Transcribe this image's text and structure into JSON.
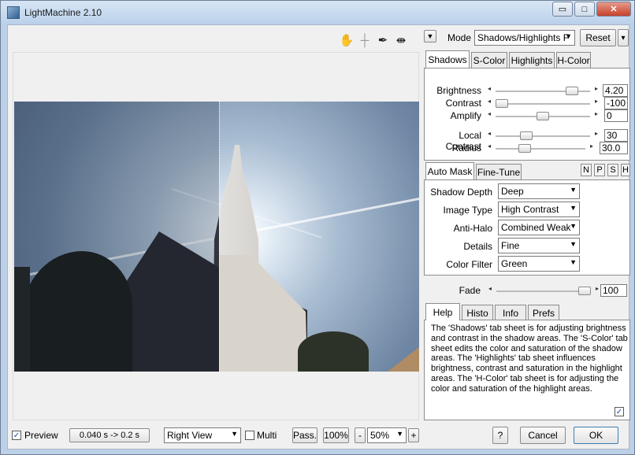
{
  "window": {
    "title": "LightMachine 2.10",
    "minimize": "▭",
    "maximize": "□",
    "close": "✕"
  },
  "toolbar": {
    "icons": [
      "hand-icon",
      "crosshair-icon",
      "eyedropper-icon",
      "split-view-icon"
    ],
    "hand": "✋",
    "cross": "┼",
    "dropper": "✒",
    "split": "⇼"
  },
  "mode": {
    "menu_arrow": "▼",
    "label": "Mode",
    "value": "Shadows/Highlights F",
    "reset": "Reset",
    "reset_arrow": "▾"
  },
  "top_tabs": [
    "Shadows",
    "S-Color",
    "Highlights",
    "H-Color"
  ],
  "sliders": [
    {
      "label": "Brightness",
      "value": "4.20",
      "level": 0.86
    },
    {
      "label": "Contrast",
      "value": "-100",
      "level": 0.0
    },
    {
      "label": "Amplify",
      "value": "0",
      "level": 0.5
    },
    {
      "label": "Local Contrast",
      "value": "30",
      "level": 0.3
    },
    {
      "label": "Radius",
      "value": "30.0",
      "level": 0.3
    }
  ],
  "mask_tabs": [
    "Auto Mask",
    "Fine-Tune"
  ],
  "mask_buttons": [
    "N",
    "P",
    "S",
    "H"
  ],
  "mask": [
    {
      "label": "Shadow Depth",
      "value": "Deep"
    },
    {
      "label": "Image Type",
      "value": "High Contrast"
    },
    {
      "label": "Anti-Halo",
      "value": "Combined Weak"
    },
    {
      "label": "Details",
      "value": "Fine"
    },
    {
      "label": "Color Filter",
      "value": "Green"
    }
  ],
  "fade": {
    "label": "Fade",
    "value": "100",
    "level": 1.0
  },
  "help_tabs": [
    "Help",
    "Histo",
    "Info",
    "Prefs"
  ],
  "help_text": "The 'Shadows' tab sheet is for adjusting brightness and contrast in the shadow areas. The 'S-Color' tab sheet edits the color and saturation of the shadow areas. The 'Highlights' tab sheet influences brightness, contrast and saturation in the highlight areas. The 'H-Color' tab sheet is for adjusting the color and saturation of the highlight areas.",
  "help_checked": "✓",
  "bottom": {
    "preview_check": "✓",
    "preview_label": "Preview",
    "timing": "0.040 s -> 0.2 s",
    "view": "Right View",
    "multi_label": "Multi",
    "pass": "Pass.",
    "zoom100": "100%",
    "minus": "-",
    "zoom": "50%",
    "plus": "+",
    "help": "?",
    "cancel": "Cancel",
    "ok": "OK"
  }
}
